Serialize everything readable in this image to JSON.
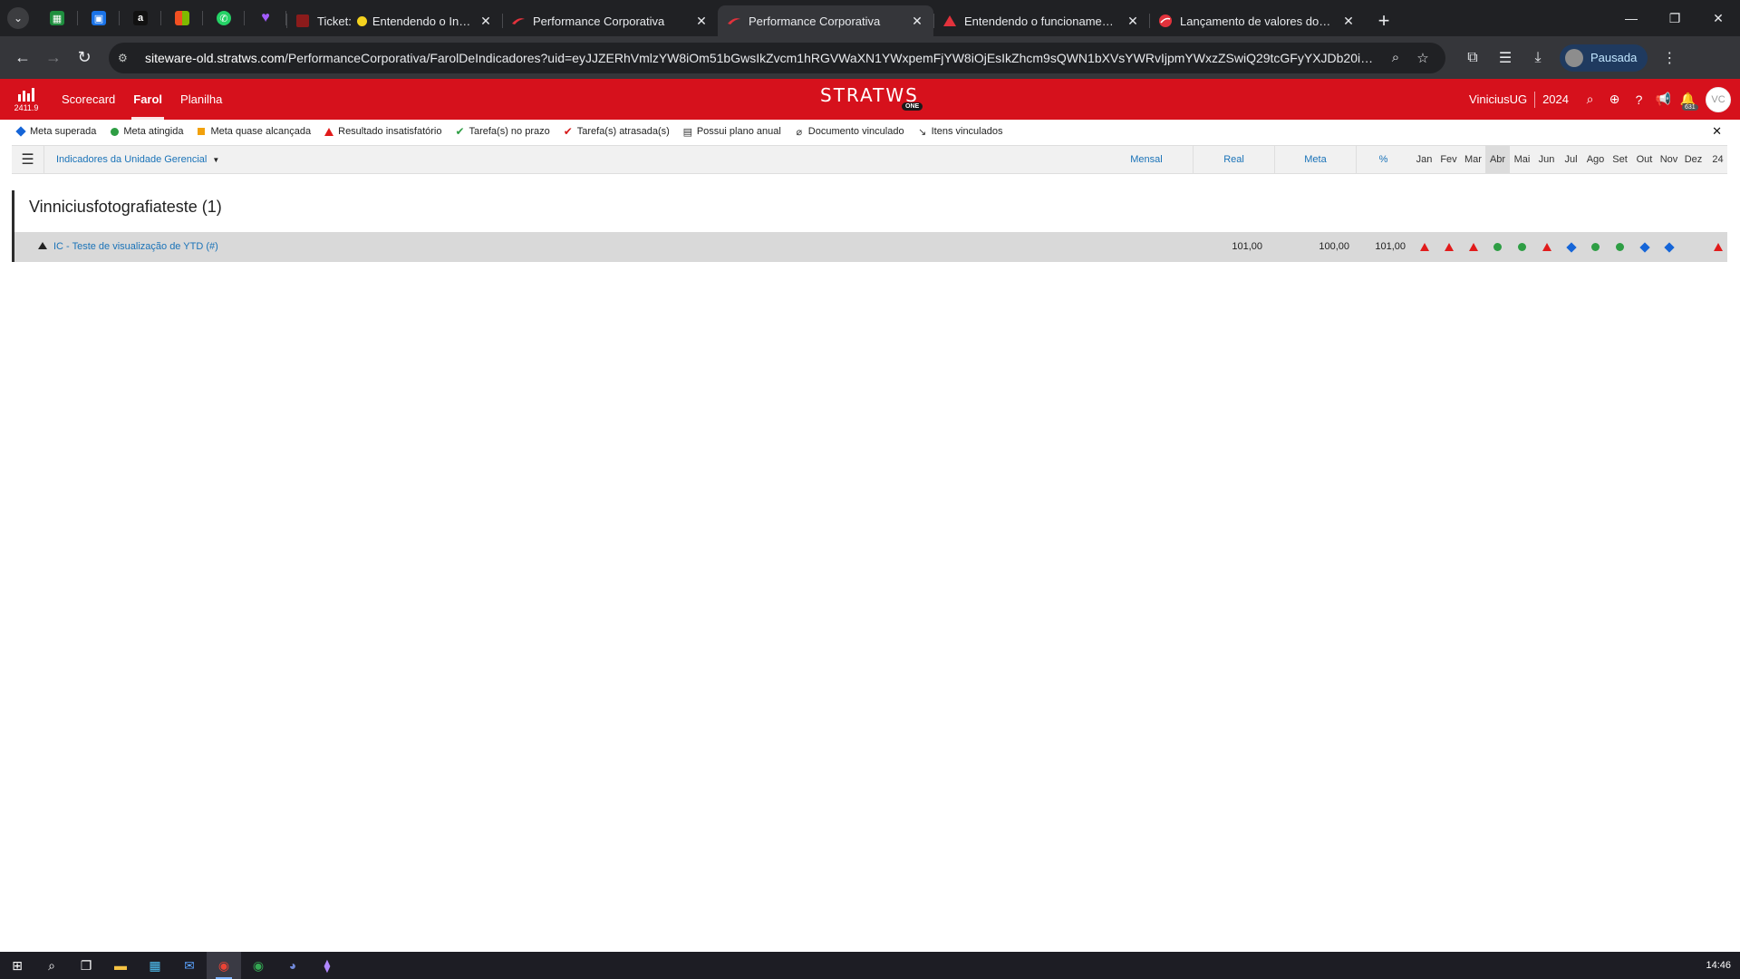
{
  "browser": {
    "tabs": [
      {
        "title_prefix": "Ticket:",
        "title": "Entendendo o Indica",
        "active": false
      },
      {
        "title": "Performance Corporativa",
        "active": false
      },
      {
        "title": "Performance Corporativa",
        "active": true
      },
      {
        "title": "Entendendo o funcionamento d",
        "active": false
      },
      {
        "title": "Lançamento de valores dos indi",
        "active": false
      }
    ],
    "url_host": "siteware-old.stratws.com",
    "url_path": "/PerformanceCorporativa/FarolDeIndicadores?uid=eyJJZERhVmlzYW8iOm51bGwsIkZvcm1hRGVWaXN1YWxpemFjYW8iOjEsIkZhcm9sQWN1bXVsYWRvIjpmYWxzZSwiQ29tcGFyYXJDb20iOjMsIkNvbXBhcm",
    "profile_label": "Pausada"
  },
  "app": {
    "version": "2411.9",
    "nav": [
      "Scorecard",
      "Farol",
      "Planilha"
    ],
    "active_nav": "Farol",
    "brand": "STRATWS",
    "brand_badge": "ONE",
    "user": "ViniciusUG",
    "year": "2024",
    "notif_count": "631",
    "avatar_initials": "VC"
  },
  "legend": [
    {
      "marker": "diamond",
      "label": "Meta superada"
    },
    {
      "marker": "circle",
      "label": "Meta atingida"
    },
    {
      "marker": "square",
      "label": "Meta quase alcançada"
    },
    {
      "marker": "triangle",
      "label": "Resultado insatisfatório"
    },
    {
      "marker": "check-green",
      "label": "Tarefa(s) no prazo"
    },
    {
      "marker": "check-red",
      "label": "Tarefa(s) atrasada(s)"
    },
    {
      "marker": "plan",
      "label": "Possui plano anual"
    },
    {
      "marker": "clip",
      "label": "Documento vinculado"
    },
    {
      "marker": "link",
      "label": "Itens vinculados"
    }
  ],
  "grid": {
    "unit_selector": "Indicadores da Unidade Gerencial",
    "period": "Mensal",
    "col_real": "Real",
    "col_meta": "Meta",
    "col_pct": "%",
    "months": [
      "Jan",
      "Fev",
      "Mar",
      "Abr",
      "Mai",
      "Jun",
      "Jul",
      "Ago",
      "Set",
      "Out",
      "Nov",
      "Dez",
      "24"
    ],
    "current_month": "Abr"
  },
  "group": {
    "title": "Vinniciusfotografiateste (1)",
    "indicators": [
      {
        "name": "IC - Teste de visualização de YTD (#)",
        "real": "101,00",
        "meta": "100,00",
        "pct": "101,00",
        "statuses": [
          "triangle",
          "triangle",
          "triangle",
          "circle",
          "circle",
          "triangle",
          "diamond",
          "circle",
          "circle",
          "diamond",
          "diamond",
          "",
          "triangle"
        ]
      }
    ]
  },
  "taskbar": {
    "time": "14:46"
  },
  "colors": {
    "brand_red": "#d6111c",
    "diamond": "#1565d8",
    "circle": "#2e9e44",
    "square": "#f2a10c",
    "triangle": "#e11b1b",
    "link_blue": "#1a73b8"
  }
}
